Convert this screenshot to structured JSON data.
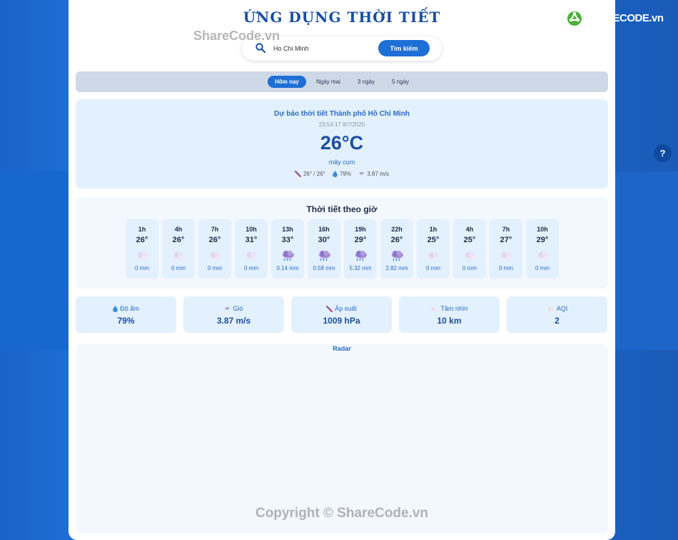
{
  "app": {
    "title": "ỨNG DỤNG THỜI TIẾT"
  },
  "search": {
    "value": "Ho Chi Minh",
    "button_label": "Tìm kiếm"
  },
  "watermark": {
    "top": "ShareCode.vn",
    "bottom": "Copyright © ShareCode.vn"
  },
  "logo": {
    "text": "SHARECODE.vn"
  },
  "help": {
    "label": "?"
  },
  "tabs": [
    {
      "label": "Hôm nay",
      "active": true
    },
    {
      "label": "Ngày mai",
      "active": false
    },
    {
      "label": "3 ngày",
      "active": false
    },
    {
      "label": "5 ngày",
      "active": false
    }
  ],
  "current": {
    "title": "Dự báo thời tiết Thành phố Hồ Chí Minh",
    "datetime": "23:54:17 8/7/2025",
    "temp": "26°C",
    "description": "mây cụm",
    "minmax": "26° / 26°",
    "humidity": "79%",
    "wind": "3.87 m/s"
  },
  "hourly": {
    "title": "Thời tiết theo giờ",
    "items": [
      {
        "time": "1h",
        "temp": "26°",
        "rain": "0 mm",
        "icon": "cloud-icon"
      },
      {
        "time": "4h",
        "temp": "26°",
        "rain": "0 mm",
        "icon": "cloud-icon"
      },
      {
        "time": "7h",
        "temp": "26°",
        "rain": "0 mm",
        "icon": "cloud-icon"
      },
      {
        "time": "10h",
        "temp": "31°",
        "rain": "0 mm",
        "icon": "cloud-icon"
      },
      {
        "time": "13h",
        "temp": "33°",
        "rain": "0.14 mm",
        "icon": "rain-cloud-icon"
      },
      {
        "time": "16h",
        "temp": "30°",
        "rain": "0.58 mm",
        "icon": "rain-cloud-icon"
      },
      {
        "time": "19h",
        "temp": "29°",
        "rain": "5.32 mm",
        "icon": "rain-cloud-icon"
      },
      {
        "time": "22h",
        "temp": "26°",
        "rain": "2.82 mm",
        "icon": "rain-cloud-icon"
      },
      {
        "time": "1h",
        "temp": "25°",
        "rain": "0 mm",
        "icon": "cloud-icon"
      },
      {
        "time": "4h",
        "temp": "25°",
        "rain": "0 mm",
        "icon": "cloud-icon"
      },
      {
        "time": "7h",
        "temp": "27°",
        "rain": "0 mm",
        "icon": "cloud-icon"
      },
      {
        "time": "10h",
        "temp": "29°",
        "rain": "0 mm",
        "icon": "cloud-icon"
      }
    ]
  },
  "stats": [
    {
      "label": "Độ ẩm",
      "value": "79%",
      "icon": "droplet-icon"
    },
    {
      "label": "Gió",
      "value": "3.87 m/s",
      "icon": "wind-icon"
    },
    {
      "label": "Áp suất",
      "value": "1009 hPa",
      "icon": "thermometer-icon"
    },
    {
      "label": "Tầm nhìn",
      "value": "10 km",
      "icon": "fog-icon"
    },
    {
      "label": "AQI",
      "value": "2",
      "icon": "air-icon"
    }
  ],
  "radar": {
    "title": "Radar"
  },
  "colors": {
    "accent": "#1e6fd6",
    "title": "#1a4fa0",
    "card": "#e3f0fd"
  }
}
